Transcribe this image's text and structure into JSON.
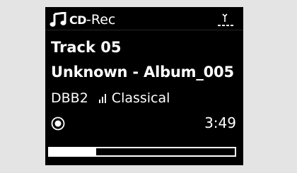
{
  "header": {
    "logo": "CD",
    "mode": "-Rec",
    "icons": [
      "music-note-icon",
      "antenna-signal-icon"
    ]
  },
  "track": {
    "label": "Track 05"
  },
  "album": {
    "title": "Unknown - Album_005"
  },
  "source": {
    "station": "DBB2",
    "genre": "Classical",
    "genre_icon": "signal-bars-icon"
  },
  "status": {
    "icon": "record-icon",
    "time": "3:49"
  },
  "progress": {
    "fraction": 0.25
  },
  "colors": {
    "screen": "#000000",
    "text": "#ffffff",
    "frame": "#e4e4e4"
  }
}
